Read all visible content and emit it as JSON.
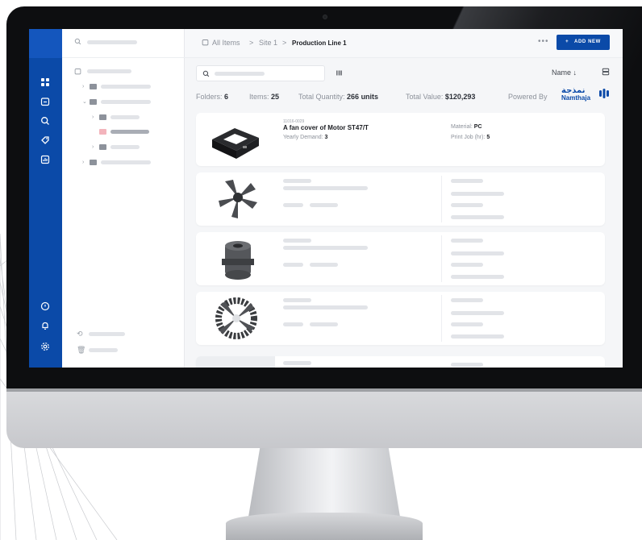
{
  "breadcrumb": {
    "root": "All Items",
    "site": "Site 1",
    "current": "Production Line 1",
    "sep": ">"
  },
  "topbar": {
    "more": "•••",
    "add_plus": "+",
    "add_label": "ADD NEW"
  },
  "toolbar": {
    "sort_label": "Name ↓"
  },
  "stats": {
    "folders_label": "Folders:",
    "folders_value": "6",
    "items_label": "Items:",
    "items_value": "25",
    "quantity_label": "Total Quantity:",
    "quantity_value": "266 units",
    "value_label": "Total Value:",
    "value_value": "$120,293",
    "powered_label": "Powered By",
    "brand_ar": "نمذجة",
    "brand_en": "Namthaja"
  },
  "items": [
    {
      "id": "11016-0029",
      "name": "A fan cover of Motor ST47/T",
      "demand_label": "Yearly Demand:",
      "demand_value": "3",
      "material_label": "Material:",
      "material_value": "PC",
      "print_label": "Print Job (hr):",
      "print_value": "5"
    }
  ],
  "colors": {
    "primary": "#0b4aa8",
    "rail": "#0b4aa8",
    "background": "#f5f6f8"
  },
  "icons": {
    "rail": [
      "grid-icon",
      "calendar-icon",
      "search-icon",
      "tag-icon",
      "chart-icon",
      "chat-icon",
      "bell-icon",
      "settings-icon"
    ]
  }
}
